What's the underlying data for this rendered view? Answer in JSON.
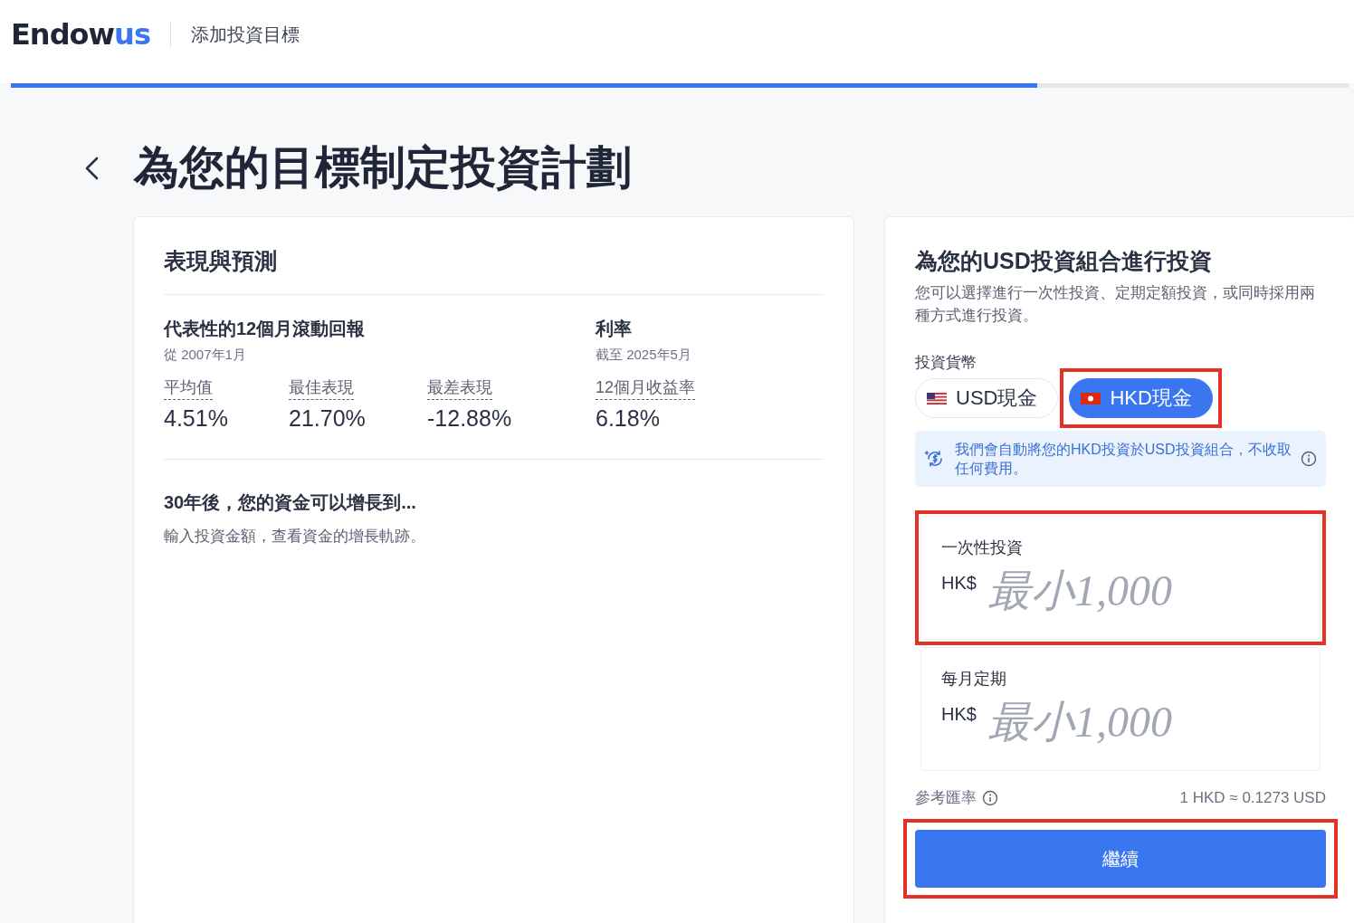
{
  "header": {
    "logo": {
      "main": "Endow",
      "accent": "us"
    },
    "title": "添加投資目標"
  },
  "progress": {
    "level": 0.767
  },
  "page_title": "為您的目標制定投資計劃",
  "performance": {
    "title": "表現與預測",
    "returns": {
      "title": "代表性的12個月滾動回報",
      "subtitle": "從 2007年1月",
      "stats": [
        {
          "label": "平均值",
          "value": "4.51%"
        },
        {
          "label": "最佳表現",
          "value": "21.70%"
        },
        {
          "label": "最差表現",
          "value": "-12.88%"
        }
      ]
    },
    "rate": {
      "title": "利率",
      "subtitle": "截至 2025年5月",
      "stats": [
        {
          "label": "12個月收益率",
          "value": "6.18%"
        }
      ]
    },
    "projection": {
      "title": "30年後，您的資金可以增長到...",
      "hint": "輸入投資金額，查看資金的增長軌跡。"
    }
  },
  "invest": {
    "title": "為您的USD投資組合進行投資",
    "description": "您可以選擇進行一次性投資、定期定額投資，或同時採用兩種方式進行投資。",
    "currency_label": "投資貨幣",
    "currencies": [
      {
        "kind": "us",
        "label": "USD現金",
        "selected": false,
        "highlighted": false
      },
      {
        "kind": "hk",
        "label": "HKD現金",
        "selected": true,
        "highlighted": true
      }
    ],
    "notice": "我們會自動將您的HKD投資於USD投資組合，不收取任何費用。",
    "amounts": [
      {
        "label": "一次性投資",
        "currency": "HK$",
        "placeholder": "最小1,000",
        "highlighted": true
      },
      {
        "label": "每月定期",
        "currency": "HK$",
        "placeholder": "最小1,000",
        "highlighted": false
      }
    ],
    "rate_label": "參考匯率",
    "rate_value": "1 HKD ≈ 0.1273 USD",
    "continue_button": {
      "label": "繼續",
      "highlighted": true
    }
  }
}
